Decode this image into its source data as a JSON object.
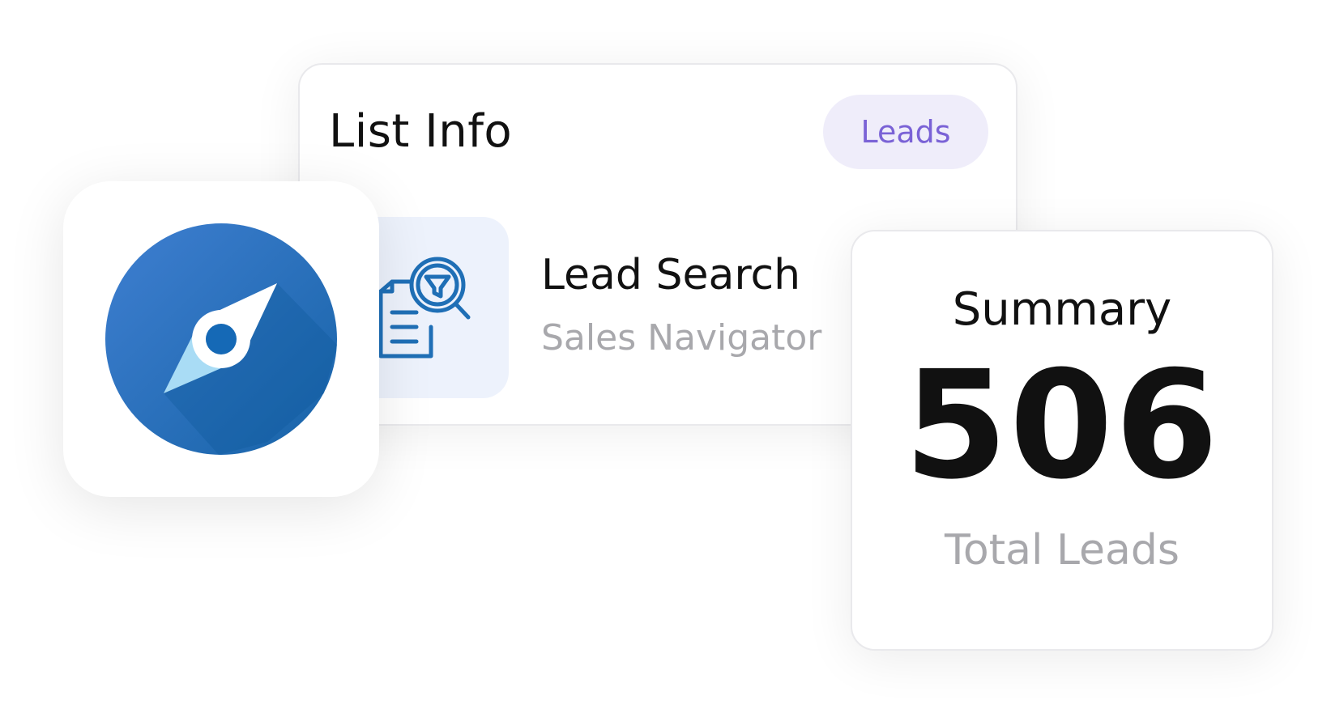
{
  "list_card": {
    "title": "List Info",
    "badge": "Leads",
    "badge_color": "#7a62d6",
    "source": {
      "icon": "document-filter-search-icon",
      "name": "Lead Search",
      "subtitle": "Sales Navigator"
    }
  },
  "app_tile": {
    "icon": "compass-icon",
    "accent": "#2a72c0"
  },
  "summary_card": {
    "title": "Summary",
    "value": "506",
    "label": "Total Leads"
  }
}
